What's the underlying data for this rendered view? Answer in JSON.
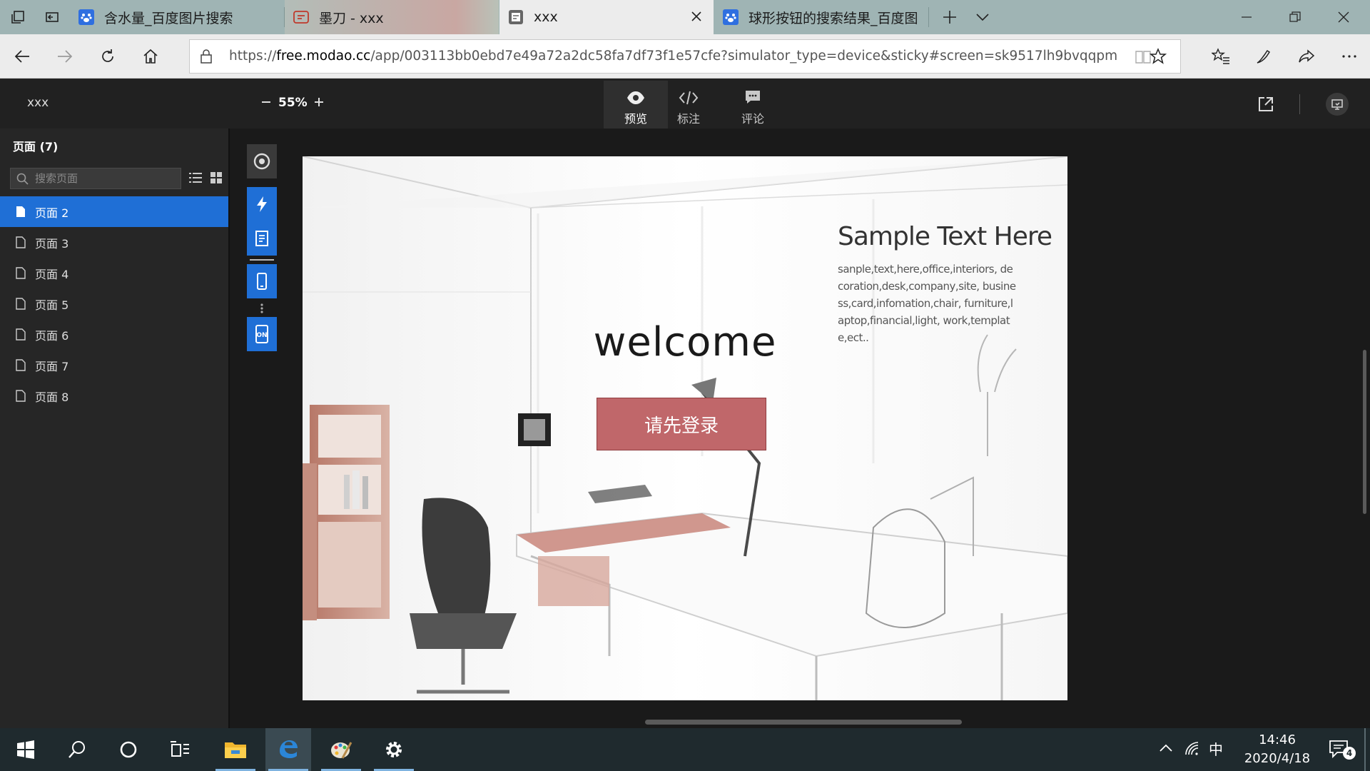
{
  "browser": {
    "tabs": [
      {
        "title": "含水量_百度图片搜索",
        "icon": "baidu-paw-icon"
      },
      {
        "title": "墨刀 - xxx",
        "icon": "modao-icon"
      },
      {
        "title": "xxx",
        "icon": "page-icon",
        "active": true
      },
      {
        "title": "球形按钮的搜索结果_百度图",
        "icon": "baidu-paw-icon"
      }
    ],
    "url_prefix": "https://",
    "url_domain": "free.modao.cc",
    "url_path": "/app/003113bb0ebd7e49a72a2dc58fa7df73f1e57cfe?simulator_type=device&sticky#screen=sk9517lh9bvqqpm"
  },
  "app": {
    "project_name": "xxx",
    "zoom": "55%",
    "modes": [
      {
        "label": "预览",
        "icon": "eye-icon",
        "active": true
      },
      {
        "label": "标注",
        "icon": "code-icon"
      },
      {
        "label": "评论",
        "icon": "comment-icon"
      }
    ]
  },
  "sidebar": {
    "title": "页面 (7)",
    "search_placeholder": "搜索页面",
    "pages": [
      {
        "label": "页面 2",
        "selected": true
      },
      {
        "label": "页面 3"
      },
      {
        "label": "页面 4"
      },
      {
        "label": "页面 5"
      },
      {
        "label": "页面 6"
      },
      {
        "label": "页面 7"
      },
      {
        "label": "页面 8"
      }
    ]
  },
  "artboard": {
    "welcome": "welcome",
    "login_button": "请先登录",
    "sample_title": "Sample Text Here",
    "sample_body": "sanple,text,here,office,interiors, decoration,desk,company,site, business,card,infomation,chair, furniture,laptop,financial,light, work,template,ect..",
    "accent_color": "#c0676a"
  },
  "taskbar": {
    "time": "14:46",
    "date": "2020/4/18",
    "ime": "中",
    "notification_count": "4"
  }
}
